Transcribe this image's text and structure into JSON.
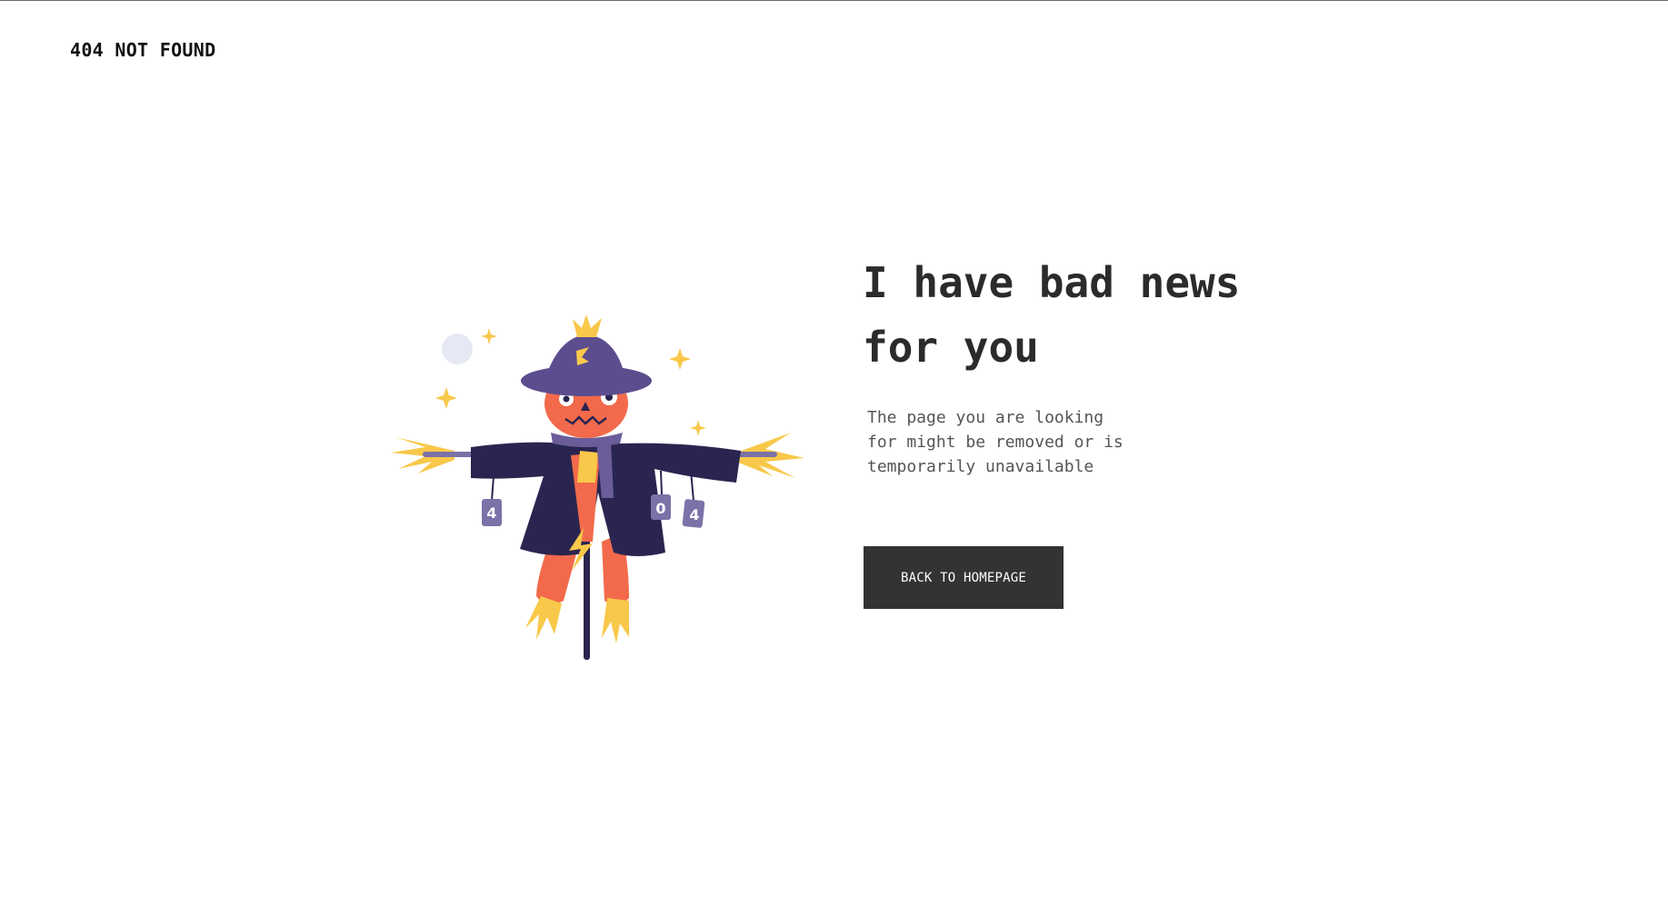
{
  "header": {
    "title": "404 NOT FOUND"
  },
  "illustration": {
    "name": "scarecrow-illustration",
    "can_labels": [
      "4",
      "0",
      "4"
    ],
    "colors": {
      "coat": "#2a2550",
      "hat": "#5c4d8e",
      "face": "#f26a4b",
      "straw": "#f8c84a",
      "scarf": "#6a5d99",
      "cans": "#7b72a8",
      "moon": "#e6e9f4"
    }
  },
  "main": {
    "headline": "I have bad news for you",
    "description": "The page you are looking for might be removed or is temporarily unavailable",
    "button_label": "BACK TO HOMEPAGE"
  },
  "colors": {
    "background": "#ffffff",
    "text_dark": "#2b2b2b",
    "button_bg": "#333333",
    "button_text": "#ffffff"
  }
}
